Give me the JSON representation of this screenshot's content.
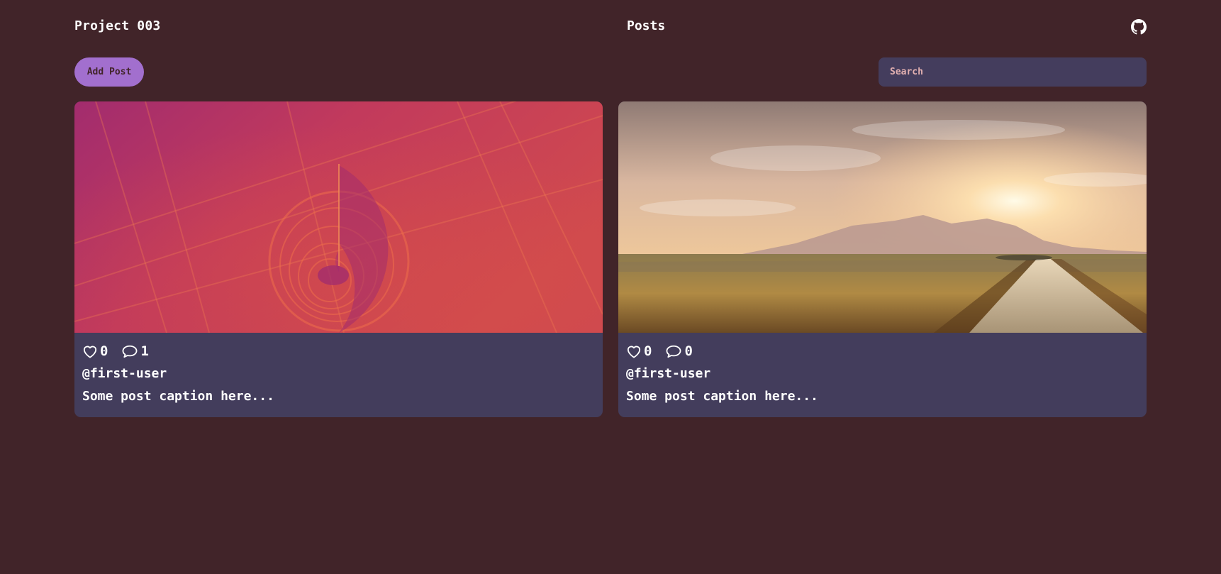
{
  "header": {
    "brand": "Project 003",
    "title": "Posts",
    "github_icon": "github-icon"
  },
  "toolbar": {
    "add_label": "Add Post",
    "search_placeholder": "Search"
  },
  "colors": {
    "background": "#412429",
    "card": "#433d5c",
    "accent": "#a26fce",
    "search_bg": "#443d5d"
  },
  "posts": [
    {
      "image": "abstract-magenta-spiral",
      "likes": "0",
      "comments": "1",
      "user": "@first-user",
      "caption": "Some post caption here..."
    },
    {
      "image": "sunset-field-path",
      "likes": "0",
      "comments": "0",
      "user": "@first-user",
      "caption": "Some post caption here..."
    }
  ]
}
